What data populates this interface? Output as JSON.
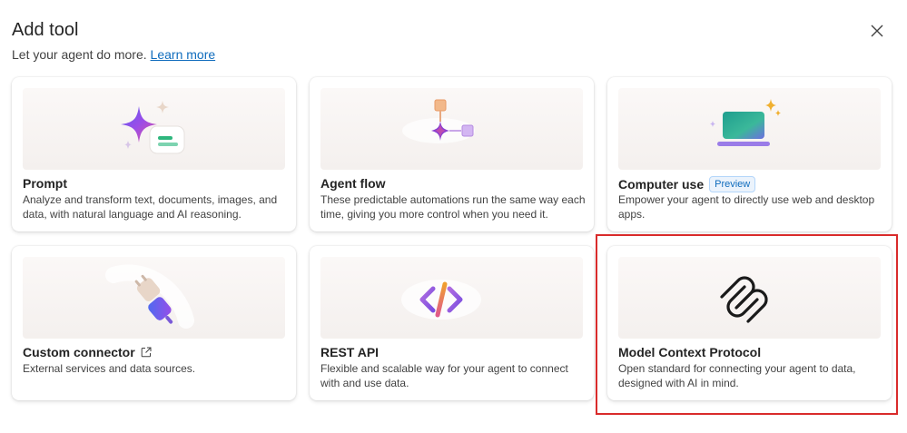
{
  "header": {
    "title": "Add tool",
    "subtitle": "Let your agent do more.",
    "learn_more": "Learn more"
  },
  "cards": [
    {
      "title": "Prompt",
      "description": "Analyze and transform text, documents, images, and data, with natural language and AI reasoning.",
      "icon": "sparkle-prompt-icon"
    },
    {
      "title": "Agent flow",
      "description": "These predictable automations run the same way each time, giving you more control when you need it.",
      "icon": "flow-icon"
    },
    {
      "title": "Computer use",
      "badge": "Preview",
      "description": "Empower your agent to directly use web and desktop apps.",
      "icon": "computer-icon"
    },
    {
      "title": "Custom connector",
      "description": "External services and data sources.",
      "icon": "plug-icon"
    },
    {
      "title": "REST API",
      "description": "Flexible and scalable way for your agent to connect with and use data.",
      "icon": "code-icon"
    },
    {
      "title": "Model Context Protocol",
      "description": "Open standard for connecting your agent to data, designed with AI in mind.",
      "icon": "mcp-icon"
    }
  ],
  "colors": {
    "accent": "#0f6cbd",
    "highlight": "#d92b2b"
  }
}
